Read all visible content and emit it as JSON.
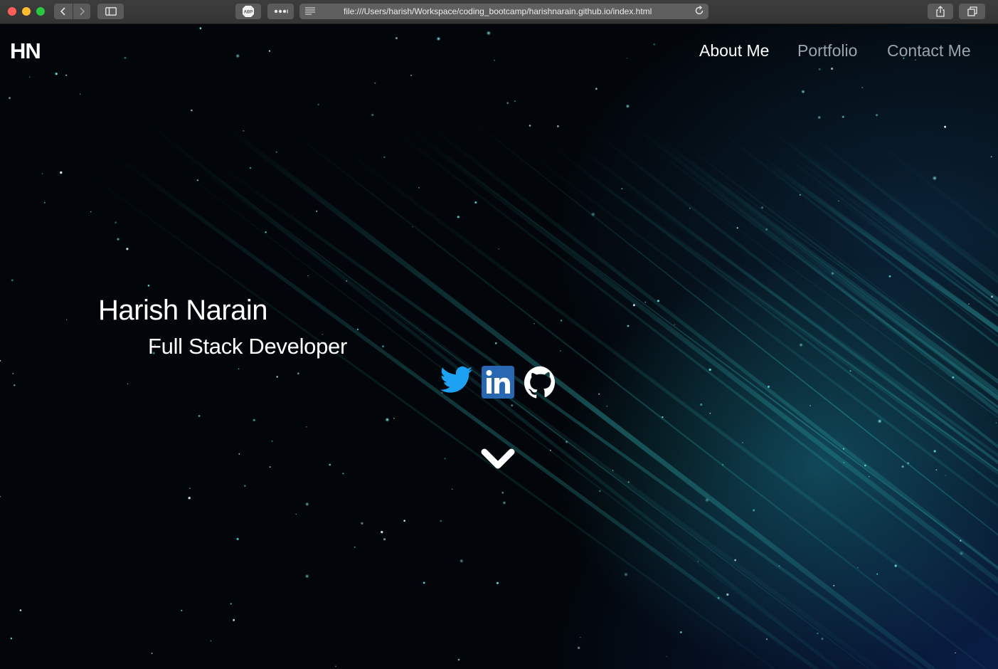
{
  "browser": {
    "url": "file:///Users/harish/Workspace/coding_bootcamp/harishnarain.github.io/index.html",
    "icons": [
      "back-icon",
      "forward-icon",
      "sidebar-icon",
      "adblock-icon",
      "more-icon",
      "reader-icon",
      "reload-icon",
      "share-icon",
      "tabs-icon"
    ],
    "abp_label": "ABP"
  },
  "header": {
    "logo": "HN",
    "nav": [
      "About Me",
      "Portfolio",
      "Contact Me"
    ]
  },
  "hero": {
    "name": "Harish Narain",
    "title": "Full Stack Developer"
  },
  "social": [
    {
      "name": "twitter-icon",
      "color": "#1da1f2"
    },
    {
      "name": "linkedin-icon",
      "color": "#2867b2"
    },
    {
      "name": "github-icon",
      "color": "#ffffff"
    }
  ],
  "scroll_icon": "chevron-down-icon",
  "colors": {
    "nav_active": "#ffffff",
    "nav_inactive": "#9aa4ad",
    "accent_glow": "#3fd6d6"
  }
}
